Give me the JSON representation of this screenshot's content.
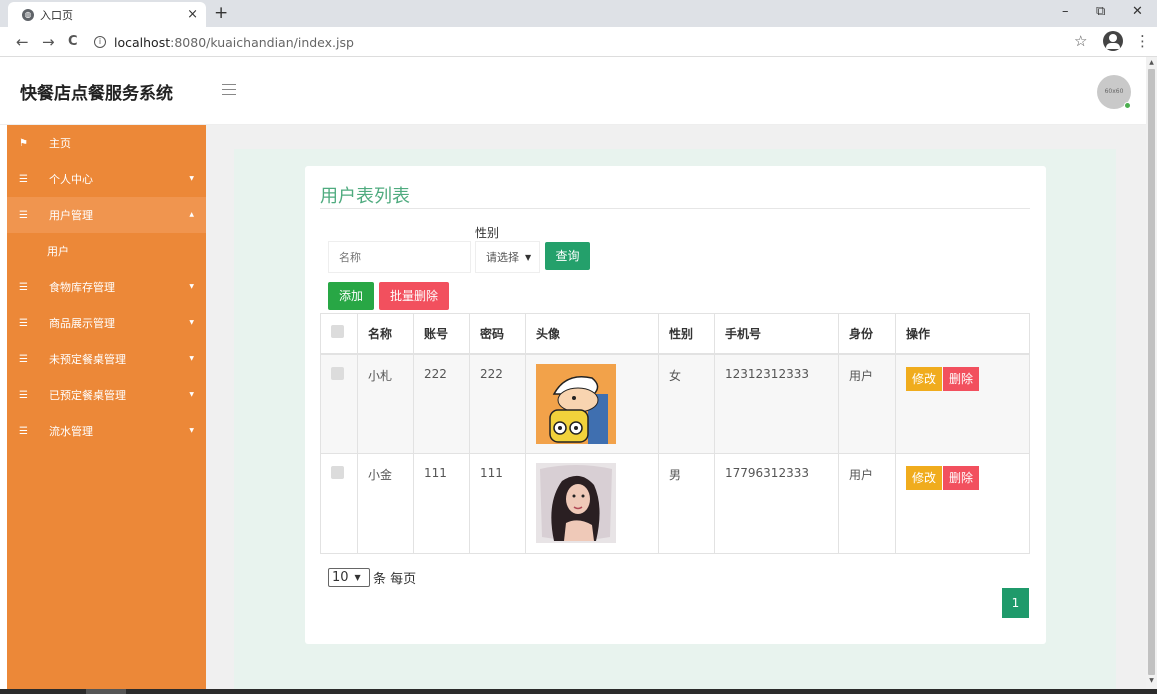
{
  "browser": {
    "tab_title": "入口页",
    "tab_close": "×",
    "new_tab": "+",
    "url_host": "localhost",
    "url_rest": ":8080/kuaichandian/index.jsp",
    "back": "←",
    "forward": "→",
    "reload": "C",
    "star": "☆",
    "kebab": "⋮",
    "minimize": "–",
    "restore": "⧉",
    "close": "✕"
  },
  "header": {
    "app_title": "快餐店点餐服务系统",
    "avatar_text": "60x60"
  },
  "sidebar": {
    "items": [
      {
        "label": "主页",
        "icon": "flag-icon"
      },
      {
        "label": "个人中心",
        "icon": "grid-icon"
      },
      {
        "label": "用户管理",
        "icon": "grid-icon"
      },
      {
        "label": "食物库存管理",
        "icon": "grid-icon"
      },
      {
        "label": "商品展示管理",
        "icon": "grid-icon"
      },
      {
        "label": "未预定餐桌管理",
        "icon": "grid-icon"
      },
      {
        "label": "已预定餐桌管理",
        "icon": "grid-icon"
      },
      {
        "label": "流水管理",
        "icon": "grid-icon"
      }
    ],
    "sub_item": "用户",
    "active_bg": "#f0954f",
    "bg": "#ec8838"
  },
  "main": {
    "title": "用户表列表",
    "search_placeholder": "名称",
    "gender_label": "性别",
    "gender_select": "请选择",
    "query_button": "查询",
    "add_button": "添加",
    "batch_delete_button": "批量删除",
    "columns": [
      "名称",
      "账号",
      "密码",
      "头像",
      "性别",
      "手机号",
      "身份",
      "操作"
    ],
    "rows": [
      {
        "name": "小札",
        "account": "222",
        "password": "222",
        "avatar": "cartoon-avatar-image",
        "gender": "女",
        "phone": "12312312333",
        "role": "用户"
      },
      {
        "name": "小金",
        "account": "111",
        "password": "111",
        "avatar": "portrait-avatar-image",
        "gender": "男",
        "phone": "17796312333",
        "role": "用户"
      }
    ],
    "edit_label": "修改",
    "delete_label": "删除",
    "per_page_value": "10",
    "per_page_suffix": "条 每页",
    "page_number": "1"
  },
  "colors": {
    "title_green": "#4fab7f",
    "add_green": "#28a745",
    "danger": "#f2505e",
    "edit_orange": "#f0ac1d"
  }
}
